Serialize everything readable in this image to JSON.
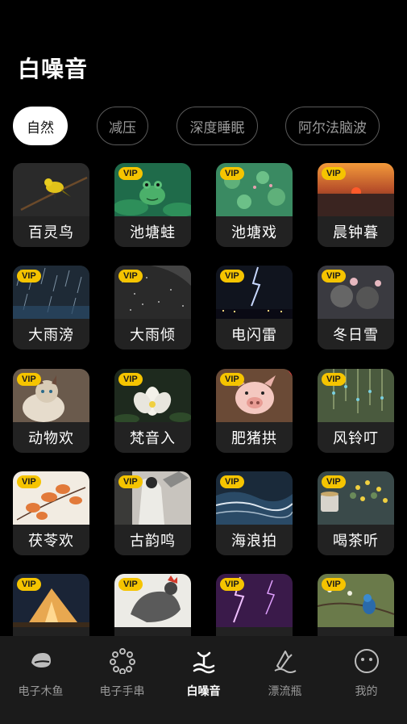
{
  "page": {
    "title": "白噪音"
  },
  "tabs": [
    {
      "label": "自然",
      "active": true
    },
    {
      "label": "减压",
      "active": false
    },
    {
      "label": "深度睡眠",
      "active": false
    },
    {
      "label": "阿尔法脑波",
      "active": false
    }
  ],
  "badge_label": "VIP",
  "sounds": [
    {
      "label": "百灵鸟",
      "vip": false,
      "icon": "bird-on-branch"
    },
    {
      "label": "池塘蛙",
      "vip": true,
      "icon": "frog-on-lily-pad"
    },
    {
      "label": "池塘戏",
      "vip": true,
      "icon": "lily-pond"
    },
    {
      "label": "晨钟暮",
      "vip": true,
      "icon": "sunset"
    },
    {
      "label": "大雨滂",
      "vip": true,
      "icon": "heavy-rain"
    },
    {
      "label": "大雨倾",
      "vip": true,
      "icon": "rain-umbrella"
    },
    {
      "label": "电闪雷",
      "vip": true,
      "icon": "lightning-night"
    },
    {
      "label": "冬日雪",
      "vip": true,
      "icon": "winter-snow"
    },
    {
      "label": "动物欢",
      "vip": true,
      "icon": "cat"
    },
    {
      "label": "梵音入",
      "vip": true,
      "icon": "white-lotus"
    },
    {
      "label": "肥猪拱",
      "vip": true,
      "icon": "pig"
    },
    {
      "label": "风铃叮",
      "vip": true,
      "icon": "wind-chimes"
    },
    {
      "label": "茯苓欢",
      "vip": true,
      "icon": "orange-leaves"
    },
    {
      "label": "古韵鸣",
      "vip": true,
      "icon": "guqin-player"
    },
    {
      "label": "海浪拍",
      "vip": true,
      "icon": "ocean-waves"
    },
    {
      "label": "喝茶听",
      "vip": true,
      "icon": "tea-cup"
    },
    {
      "label": "",
      "vip": true,
      "icon": "camping-tent"
    },
    {
      "label": "",
      "vip": true,
      "icon": "rooster-painting"
    },
    {
      "label": "",
      "vip": true,
      "icon": "purple-lightning"
    },
    {
      "label": "",
      "vip": true,
      "icon": "blue-bird-branch"
    }
  ],
  "bottom_nav": [
    {
      "label": "电子木鱼",
      "icon": "wooden-fish-icon",
      "active": false
    },
    {
      "label": "电子手串",
      "icon": "prayer-beads-icon",
      "active": false
    },
    {
      "label": "白噪音",
      "icon": "wave-icon",
      "active": true
    },
    {
      "label": "漂流瓶",
      "icon": "drift-bottle-icon",
      "active": false
    },
    {
      "label": "我的",
      "icon": "smiley-face-icon",
      "active": false
    }
  ],
  "colors": {
    "background": "#000000",
    "vip_badge": "#f5c400",
    "card_label_bg": "#222222",
    "nav_bg": "#1b1b1b"
  }
}
